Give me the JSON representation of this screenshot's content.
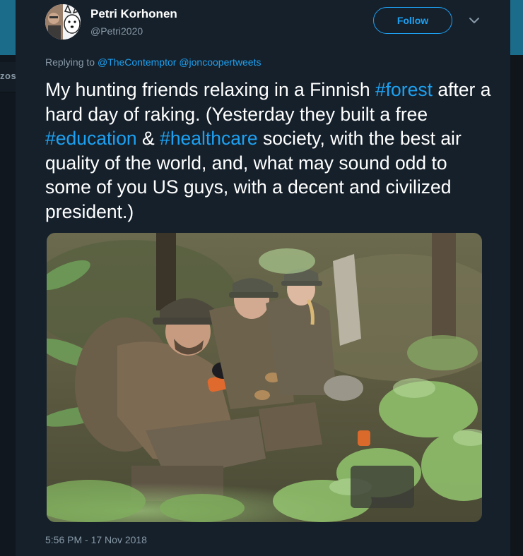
{
  "background": {
    "left_fragment": "zos"
  },
  "tweet": {
    "author": {
      "name": "Petri Korhonen",
      "handle": "@Petri2020"
    },
    "follow_label": "Follow",
    "replying_prefix": "Replying to",
    "replying_to": [
      "@TheContemptor",
      "@joncoopertweets"
    ],
    "text_parts": [
      "My hunting friends relaxing in a Finnish ",
      "#forest",
      " after a hard day of raking. (Yesterday they built a free ",
      "#education",
      " & ",
      "#healthcare",
      " society, with the best air quality of the world, and, what may sound odd to some of you US guys, with a decent and civilized president.)"
    ],
    "timestamp": "5:56 PM - 17 Nov 2018"
  },
  "colors": {
    "link": "#1da1f2",
    "card_bg": "#15202b",
    "muted": "#8899a6"
  },
  "icons": [
    "avatar",
    "chevron-down-icon"
  ]
}
